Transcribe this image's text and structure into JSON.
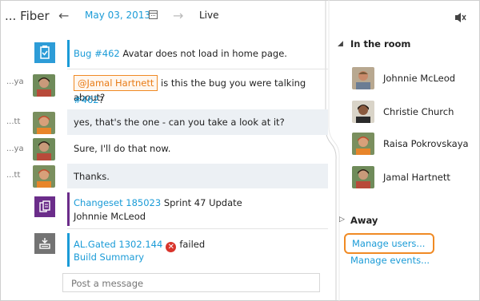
{
  "header": {
    "title": "... Fiber",
    "date": "May 03, 2013",
    "live_label": "Live"
  },
  "messages": [
    {
      "id": "bug",
      "shaded": false,
      "short_name": "",
      "link": "Bug #462",
      "text": " Avatar does not load in home page."
    },
    {
      "id": "mention",
      "shaded": false,
      "short_name": "...ya",
      "mention": "@Jamal Hartnett",
      "text": " is this the bug you were talking about?",
      "link2": "#462",
      "tail": "?"
    },
    {
      "id": "reply1",
      "shaded": true,
      "short_name": "...tt",
      "text": "yes, that's the one - can you take a look at it?"
    },
    {
      "id": "reply2",
      "shaded": false,
      "short_name": "...ya",
      "text": "Sure, I'll do that now."
    },
    {
      "id": "reply3",
      "shaded": true,
      "short_name": "...tt",
      "text": "Thanks."
    },
    {
      "id": "changeset",
      "shaded": false,
      "short_name": "",
      "link": "Changeset 185023",
      "text": " Sprint 47 Update",
      "line2": "Johnnie McLeod"
    },
    {
      "id": "build",
      "shaded": false,
      "short_name": "",
      "link": "AL.Gated 1302.144",
      "status": "failed",
      "link2": "Build Summary"
    }
  ],
  "composer": {
    "placeholder": "Post a message"
  },
  "room": {
    "in_room_label": "In the room",
    "members": [
      {
        "name": "Johnnie McLeod"
      },
      {
        "name": "Christie Church"
      },
      {
        "name": "Raisa Pokrovskaya"
      },
      {
        "name": "Jamal Hartnett"
      }
    ],
    "away_label": "Away",
    "manage_users": "Manage users...",
    "manage_events": "Manage events..."
  },
  "icons": {
    "back": "arrow-left-icon",
    "forward": "arrow-right-icon",
    "calendar": "calendar-icon",
    "speaker": "speaker-mute-icon",
    "bug": "work-item-icon",
    "changeset": "changeset-icon",
    "build": "build-icon",
    "failed": "error-icon"
  },
  "colors": {
    "accent": "#1a9bd7",
    "highlight": "#f08a24",
    "bug_tile": "#2d9cd7",
    "changeset_tile": "#6b2d8a",
    "build_tile": "#737373",
    "error": "#d9342b"
  }
}
